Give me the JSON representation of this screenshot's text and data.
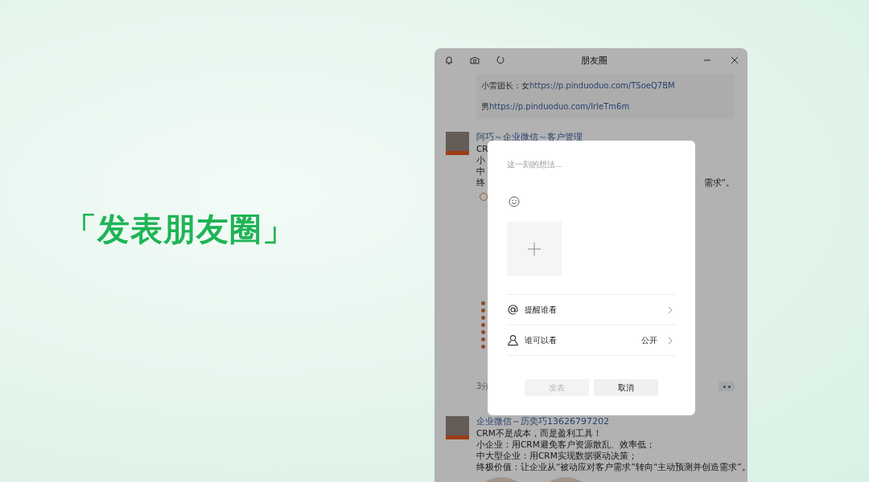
{
  "headline": "「发表朋友圈」",
  "window": {
    "title": "朋友圈"
  },
  "feed": {
    "quote": [
      {
        "prefix": "小雷团长：女",
        "link": "https://p.pinduoduo.com/TSoeQ7BM"
      },
      {
        "prefix": "男",
        "link": "https://p.pinduoduo.com/IrleTm6m"
      }
    ],
    "covered_post": {
      "author": "阿巧～企业微信～客户管理",
      "fragments": [
        {
          "left": "CR"
        },
        {
          "left": "小"
        },
        {
          "left": "中"
        },
        {
          "left": "终",
          "right": "需求”。"
        }
      ],
      "time": "3分"
    },
    "post": {
      "author": "企业微信～历奕巧13626797202",
      "lines": [
        "CRM不是成本，而是盈利工具！",
        "小企业：用CRM避免客户资源散乱、效率低；",
        "中大型企业：用CRM实现数据驱动决策；",
        "终极价值：让企业从“被动应对客户需求”转向“主动预测并创造需求”。"
      ]
    }
  },
  "dialog": {
    "placeholder": "这一刻的想法...",
    "options": [
      {
        "kind": "mention",
        "label": "提醒谁看"
      },
      {
        "kind": "visibility",
        "label": "谁可以看",
        "value": "公开"
      }
    ],
    "buttons": [
      {
        "label": "发表",
        "disabled": true
      },
      {
        "label": "取消",
        "disabled": false
      }
    ]
  }
}
